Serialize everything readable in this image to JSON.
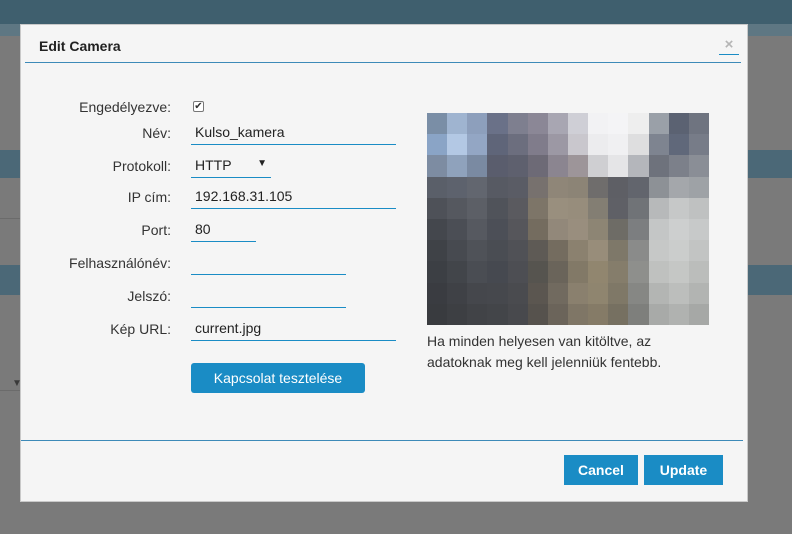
{
  "dialog": {
    "title": "Edit Camera",
    "close_glyph": "×"
  },
  "form": {
    "enabled": {
      "label": "Engedélyezve:",
      "checked": true,
      "check_glyph": "✔"
    },
    "name": {
      "label": "Név:",
      "value": "Kulso_kamera"
    },
    "protocol": {
      "label": "Protokoll:",
      "value": "HTTP",
      "arrow_glyph": "▼"
    },
    "ip": {
      "label": "IP cím:",
      "value": "192.168.31.105"
    },
    "port": {
      "label": "Port:",
      "value": "80"
    },
    "username": {
      "label": "Felhasználónév:",
      "value": ""
    },
    "password": {
      "label": "Jelszó:",
      "value": ""
    },
    "image_url": {
      "label": "Kép URL:",
      "value": "current.jpg"
    },
    "test_button": "Kapcsolat tesztelése"
  },
  "preview": {
    "hint": "Ha minden helyesen van kitöltve, az adatoknak meg kell jelenniük fentebb.",
    "pixels": [
      [
        "#7a8ea6",
        "#9fb4d0",
        "#8d9fbc",
        "#6a7188",
        "#7e7f8f",
        "#8b8796",
        "#a8a6b2",
        "#cfcfd6",
        "#f2f2f4",
        "#f4f4f6",
        "#eeeeee",
        "#9aa0a8",
        "#5b6272",
        "#6f7480"
      ],
      [
        "#8aa4c6",
        "#b3c8e4",
        "#93a6c4",
        "#5f6579",
        "#6c6e7e",
        "#807c8b",
        "#9c98a4",
        "#c9c7cd",
        "#ececee",
        "#f0f0f2",
        "#dededf",
        "#7e8490",
        "#60687a",
        "#777c88"
      ],
      [
        "#7d8ca2",
        "#8fa2bc",
        "#7a8aa2",
        "#5a5d6d",
        "#5e606e",
        "#6d6a76",
        "#8b8590",
        "#9d9599",
        "#cfcfd2",
        "#e5e5e7",
        "#b4b6bb",
        "#6e727c",
        "#7c808a",
        "#8a8e96"
      ],
      [
        "#5a5f69",
        "#5d626d",
        "#62666f",
        "#575a63",
        "#5a5c65",
        "#77716e",
        "#8f8678",
        "#8c8476",
        "#6f6d6c",
        "#5e5f65",
        "#62656d",
        "#8d9196",
        "#a4a7ab",
        "#9ea2a6"
      ],
      [
        "#4e5158",
        "#55585f",
        "#5c5f66",
        "#50535a",
        "#5a5a5f",
        "#7d7568",
        "#998f7e",
        "#978d7c",
        "#837e73",
        "#5f6066",
        "#707377",
        "#b7b9ba",
        "#c6c8c8",
        "#bfc1c1"
      ],
      [
        "#44474d",
        "#4b4e55",
        "#565960",
        "#4c4f57",
        "#56565b",
        "#746c5f",
        "#92887a",
        "#998e7e",
        "#8d8574",
        "#6e6c66",
        "#7c7e80",
        "#c4c6c6",
        "#cdcfcf",
        "#c7c9c9"
      ],
      [
        "#3f4247",
        "#474a50",
        "#4f5258",
        "#4a4d53",
        "#505156",
        "#5e5a55",
        "#746c5f",
        "#8b816f",
        "#988d7a",
        "#7e7869",
        "#8a8b8a",
        "#c6c8c7",
        "#cbcdcc",
        "#c2c4c3"
      ],
      [
        "#3c3f44",
        "#42454a",
        "#4a4d53",
        "#464950",
        "#4d4e53",
        "#56544f",
        "#6a645a",
        "#827967",
        "#91866f",
        "#857d6b",
        "#8e8f8c",
        "#bfc1bf",
        "#c5c7c5",
        "#bbbdbb"
      ],
      [
        "#3a3c41",
        "#3f4146",
        "#45474c",
        "#46484d",
        "#4a4b4f",
        "#5b5650",
        "#716a5f",
        "#8a806e",
        "#8f856f",
        "#7f7867",
        "#868784",
        "#b3b5b3",
        "#bcbebc",
        "#b2b4b2"
      ],
      [
        "#393b3f",
        "#3d3f43",
        "#414347",
        "#434549",
        "#48494d",
        "#56524d",
        "#6b645a",
        "#7f7666",
        "#857b67",
        "#767061",
        "#7e7f7c",
        "#a8aaa8",
        "#b0b2b0",
        "#a6a8a6"
      ]
    ]
  },
  "footer": {
    "cancel_label": "Cancel",
    "update_label": "Update"
  },
  "background": {
    "dropdown_glyph": "▼"
  }
}
